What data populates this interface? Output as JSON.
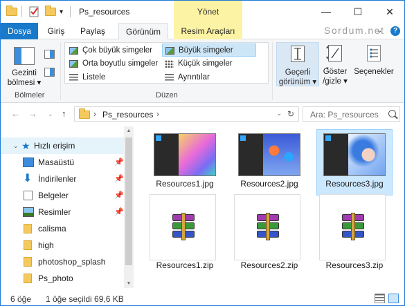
{
  "titlebar": {
    "title": "Ps_resources",
    "context_tab": "Yönet",
    "qa_dropdown": "▾",
    "minimize": "—",
    "maximize": "☐",
    "close": "✕"
  },
  "tabs": [
    {
      "label": "Dosya"
    },
    {
      "label": "Giriş"
    },
    {
      "label": "Paylaş"
    },
    {
      "label": "Görünüm"
    },
    {
      "label": "Resim Araçları"
    }
  ],
  "brand": "Sordum.net",
  "ribbon": {
    "nav_pane_label": "Gezinti\nbölmesi ▾",
    "panes_group": "Bölmeler",
    "layout_group": "Düzen",
    "layout_items": [
      {
        "label": "Çok büyük simgeler",
        "icon": "image-icon"
      },
      {
        "label": "Büyük simgeler",
        "icon": "image-icon",
        "selected": true
      },
      {
        "label": "Orta boyutlu simgeler",
        "icon": "image-icon"
      },
      {
        "label": "Küçük simgeler",
        "icon": "grid-icon"
      },
      {
        "label": "Listele",
        "icon": "list-icon"
      },
      {
        "label": "Ayrıntılar",
        "icon": "details-icon"
      }
    ],
    "current_view": "Geçerli\ngörünüm ▾",
    "show_hide": "Göster\n/gizle ▾",
    "options": "Seçenekler"
  },
  "address": {
    "path": "Ps_resources",
    "separator": "›",
    "search_placeholder": "Ara: Ps_resources"
  },
  "nav": {
    "quick_access": "Hızlı erişim",
    "items": [
      {
        "label": "Masaüstü",
        "pinned": true
      },
      {
        "label": "İndirilenler",
        "pinned": true
      },
      {
        "label": "Belgeler",
        "pinned": true
      },
      {
        "label": "Resimler",
        "pinned": true
      },
      {
        "label": "calisma",
        "pinned": false
      },
      {
        "label": "high",
        "pinned": false
      },
      {
        "label": "photoshop_splash",
        "pinned": false
      },
      {
        "label": "Ps_photo",
        "pinned": false
      }
    ],
    "pin_glyph": "📌"
  },
  "files": [
    {
      "name": "Resources1.jpg",
      "type": "jpg"
    },
    {
      "name": "Resources2.jpg",
      "type": "jpg"
    },
    {
      "name": "Resources3.jpg",
      "type": "jpg",
      "selected": true
    },
    {
      "name": "Resources1.zip",
      "type": "zip"
    },
    {
      "name": "Resources2.zip",
      "type": "zip"
    },
    {
      "name": "Resources3.zip",
      "type": "zip"
    }
  ],
  "status": {
    "count": "6 öğe",
    "selection": "1 öğe seçildi  69,6 KB"
  },
  "colors": {
    "accent": "#1979ca",
    "context_tab": "#fcf3a4",
    "selection": "#cce8ff"
  }
}
